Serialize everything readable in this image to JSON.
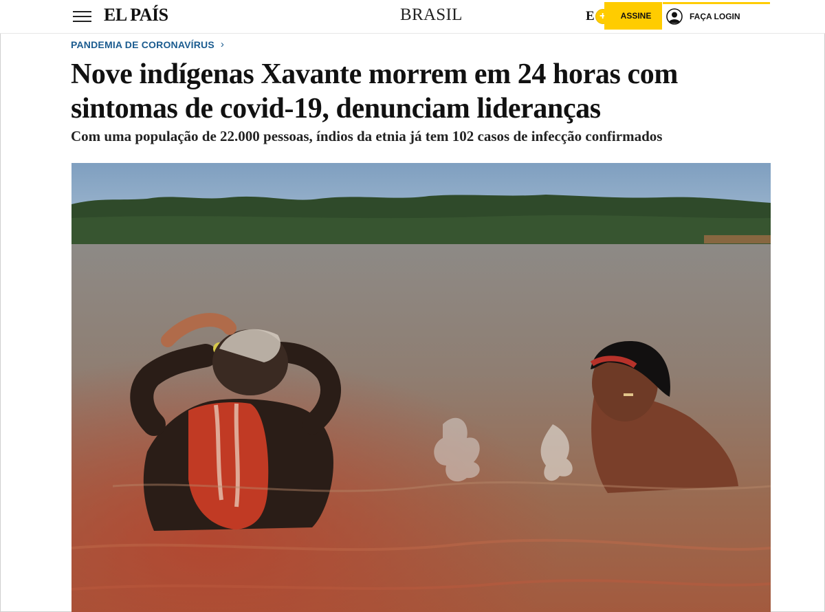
{
  "header": {
    "logo": "EL PAÍS",
    "edition": "BRASIL",
    "e_letter": "E",
    "e_plus": "+",
    "subscribe_label": "ASSINE",
    "login_label": "FAÇA LOGIN"
  },
  "article": {
    "kicker": "PANDEMIA DE CORONAVÍRUS",
    "kicker_chevron": "›",
    "headline": "Nove indígenas Xavante morrem em 24 horas com sintomas de covid-19, denunciam lideranças",
    "subtitle": "Com uma população de 22.000 pessoas, índios da etnia já tem 102 casos de infecção confirmados"
  },
  "colors": {
    "accent_yellow": "#ffcc00",
    "kicker_blue": "#1a5b8f",
    "text": "#111111"
  },
  "icons": [
    "hamburger-menu-icon",
    "user-icon",
    "chevron-right-icon"
  ]
}
